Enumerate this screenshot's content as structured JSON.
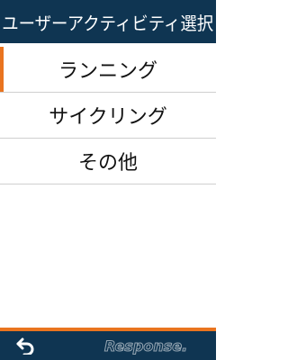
{
  "header": {
    "title": "ユーザーアクティビティ選択"
  },
  "activities": [
    {
      "label": "ランニング",
      "selected": true
    },
    {
      "label": "サイクリング",
      "selected": false
    },
    {
      "label": "その他",
      "selected": false
    }
  ],
  "footer": {
    "back_icon": "back-arrow-icon",
    "watermark": "Response."
  },
  "colors": {
    "header_bg": "#0f3552",
    "accent": "#e9741f",
    "divider": "#cfcfcf"
  }
}
